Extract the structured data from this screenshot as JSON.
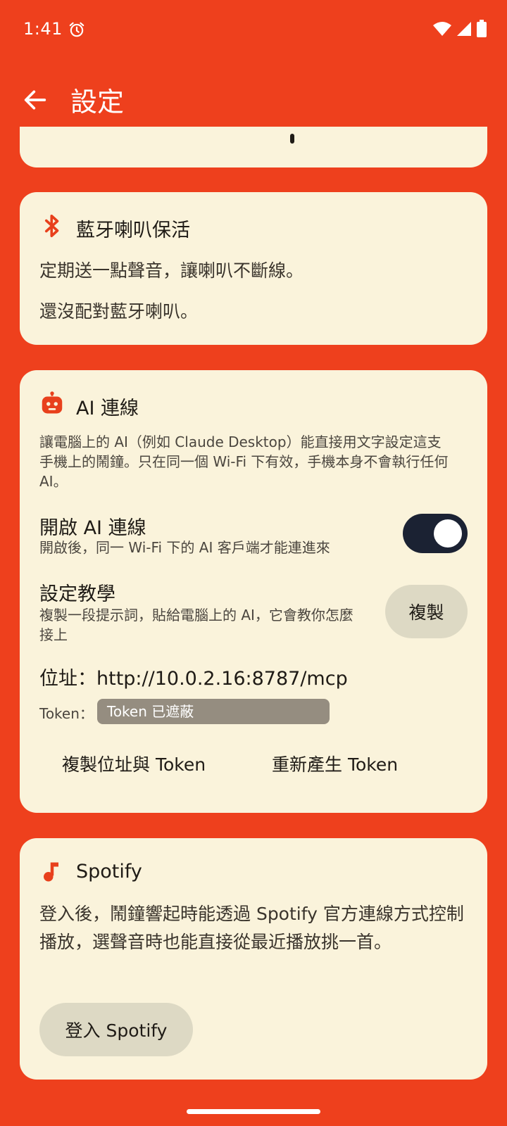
{
  "status_bar": {
    "time": "1:41"
  },
  "app_bar": {
    "title": "設定"
  },
  "bluetooth_card": {
    "title": "藍牙喇叭保活",
    "description": "定期送一點聲音，讓喇叭不斷線。",
    "status": "還沒配對藍牙喇叭。"
  },
  "ai_card": {
    "title": "AI 連線",
    "description": "讓電腦上的 AI（例如 Claude Desktop）能直接用文字設定這支手機上的鬧鐘。只在同一個 Wi-Fi 下有效，手機本身不會執行任何 AI。",
    "enable": {
      "title": "開啟 AI 連線",
      "subtitle": "開啟後，同一 Wi-Fi 下的 AI 客戶端才能連進來",
      "on": true
    },
    "tutorial": {
      "title": "設定教學",
      "subtitle": "複製一段提示詞，貼給電腦上的 AI，它會教你怎麼接上",
      "copy_button": "複製"
    },
    "address_label": "位址：",
    "address_value": "http://10.0.2.16:8787/mcp",
    "token_label": "Token：",
    "token_value": "Token 已遮蔽",
    "copy_address_token": "複製位址與 Token",
    "regenerate_token": "重新產生 Token"
  },
  "spotify_card": {
    "title": "Spotify",
    "description": "登入後，鬧鐘響起時能透過 Spotify 官方連線方式控制播放，選聲音時也能直接從最近播放挑一首。",
    "login_button": "登入 Spotify"
  },
  "colors": {
    "background": "#EE401D",
    "card": "#FAF3DB",
    "accent": "#E8401C",
    "toggle_track": "#1B2233"
  },
  "icons": [
    "alarm-icon",
    "wifi-icon",
    "cell-signal-icon",
    "battery-icon",
    "back-arrow-icon",
    "bluetooth-icon",
    "robot-icon",
    "music-note-icon"
  ]
}
